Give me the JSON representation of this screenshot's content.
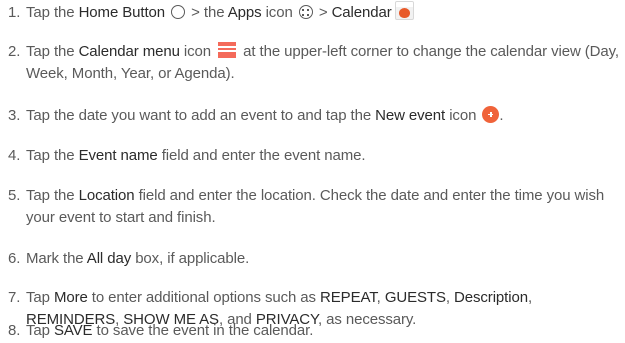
{
  "steps": [
    {
      "number": "1.",
      "pre": "Tap the ",
      "home_button": "Home Button",
      "mid1": " > the ",
      "apps": "Apps",
      "mid2": " icon ",
      "mid3": " > ",
      "calendar": "Calendar",
      "icons": [
        "home-button-icon",
        "apps-icon",
        "calendar-app-icon"
      ]
    },
    {
      "number": "2.",
      "pre": "Tap the ",
      "menu": "Calendar menu",
      "post": " icon ",
      "tail": " at the upper-left corner to change the calendar view (Day, Week, Month, Year, or Agenda).",
      "icon": "calendar-menu-icon",
      "icon_color": "#f46a5a"
    },
    {
      "number": "3.",
      "pre": "Tap the date you want to add an event to and tap the ",
      "new_event": "New event",
      "post": " icon ",
      "tail": ".",
      "icon": "new-event-icon",
      "icon_color": "#f0633a"
    },
    {
      "number": "4.",
      "pre": "Tap the ",
      "field": "Event name",
      "post": " field and enter the event name."
    },
    {
      "number": "5.",
      "pre": "Tap the ",
      "field": "Location",
      "post": " field and enter the location. Check the date and enter the time you wish your event to start and finish."
    },
    {
      "number": "6.",
      "pre": "Mark the ",
      "field": "All day",
      "post": " box, if applicable."
    },
    {
      "number": "7.",
      "pre": "Tap ",
      "more": "More",
      "mid": " to enter additional options such as ",
      "repeat": "REPEAT",
      "comma1": ", ",
      "guests": "GUESTS",
      "comma2": ", ",
      "description": "Description",
      "comma3": ", ",
      "reminders": "REMINDERS",
      "comma4": ", ",
      "show_me_as": "SHOW ME AS",
      "and": ", and ",
      "privacy": "PRIVACY",
      "tail": ", as necessary."
    },
    {
      "number": "8.",
      "pre": "Tap ",
      "save": "SAVE",
      "post": " to save the event in the calendar."
    }
  ],
  "colors": {
    "body_text": "#5a5a5a",
    "emphasis_text": "#2b2b2b"
  }
}
